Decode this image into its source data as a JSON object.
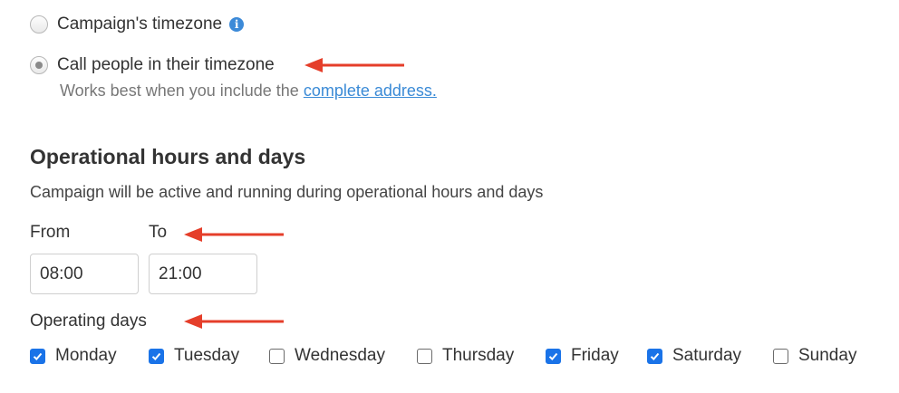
{
  "timezone_options": [
    {
      "label": "Campaign's timezone",
      "selected": false,
      "icon": "info-icon"
    },
    {
      "label": "Call people in their timezone",
      "selected": true
    }
  ],
  "hint": {
    "text": "Works best when you include the",
    "link": "complete address."
  },
  "section": {
    "title": "Operational hours and days",
    "description": "Campaign will be active and running during operational hours and days"
  },
  "from": {
    "label": "From",
    "value": "08:00"
  },
  "to": {
    "label": "To",
    "value": "21:00"
  },
  "operating_days": {
    "label": "Operating days",
    "days": [
      {
        "label": "Monday",
        "checked": true
      },
      {
        "label": "Tuesday",
        "checked": true
      },
      {
        "label": "Wednesday",
        "checked": false
      },
      {
        "label": "Thursday",
        "checked": false
      },
      {
        "label": "Friday",
        "checked": true
      },
      {
        "label": "Saturday",
        "checked": true
      },
      {
        "label": "Sunday",
        "checked": false
      }
    ]
  },
  "colors": {
    "accent": "#1a73e8",
    "link": "#3a8ad6",
    "annotation_arrow": "#e53e2a"
  }
}
